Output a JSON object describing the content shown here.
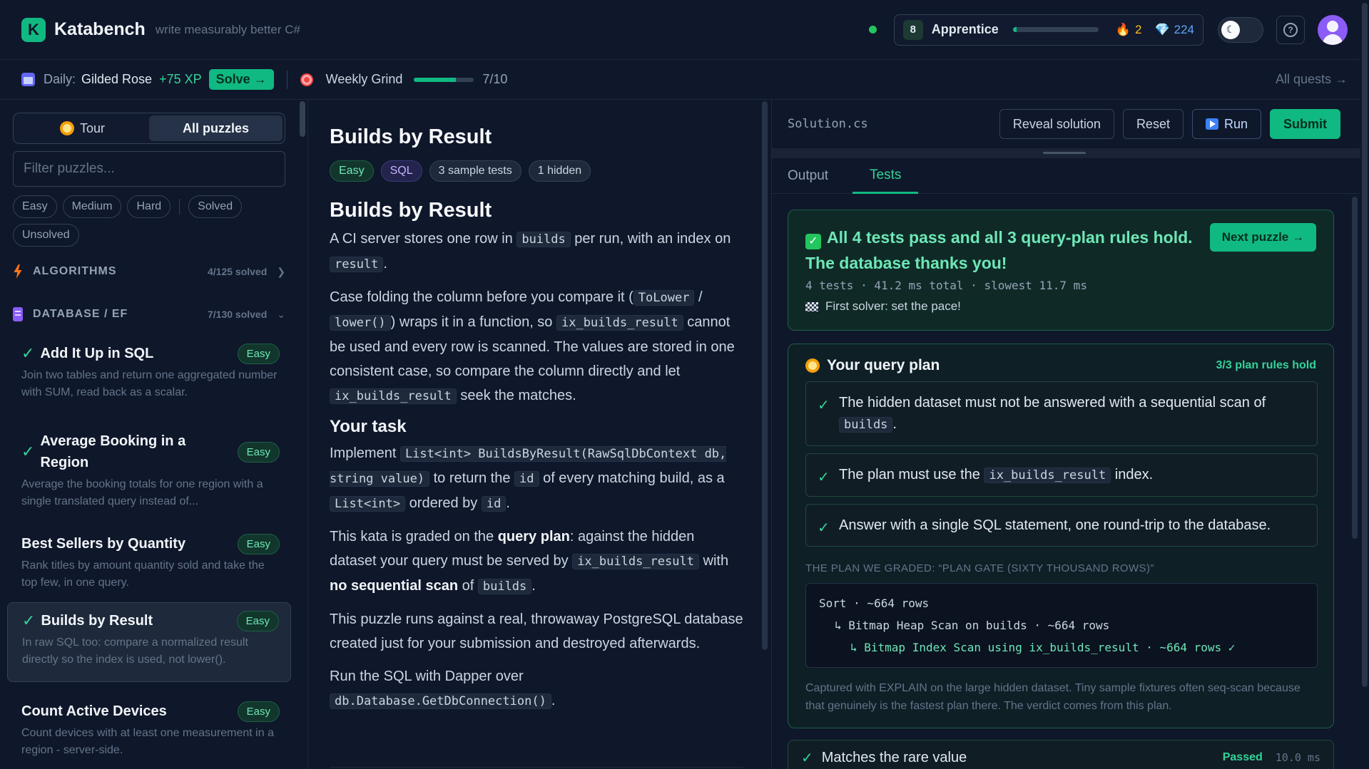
{
  "header": {
    "brand": "Katabench",
    "tagline": "write measurably better C#",
    "rank_level": "8",
    "rank_name": "Apprentice",
    "rank_progress": 0.04,
    "streak": "2",
    "gems": "224"
  },
  "quest": {
    "daily_label": "Daily:",
    "daily_name": "Gilded Rose",
    "daily_xp": "+75 XP",
    "solve_label": "Solve →",
    "weekly_label": "Weekly Grind",
    "weekly_progress": 0.7,
    "weekly_count": "7/10",
    "all_quests": "All quests →"
  },
  "sidebar": {
    "tour_label": "Tour",
    "all_label": "All puzzles",
    "filter_placeholder": "Filter puzzles...",
    "chips": [
      "Easy",
      "Medium",
      "Hard",
      "Solved",
      "Unsolved"
    ],
    "sections": [
      {
        "title": "ALGORITHMS",
        "count": "4/125 solved"
      },
      {
        "title": "DATABASE / EF",
        "count": "7/130 solved"
      }
    ],
    "puzzles": [
      {
        "title": "Add It Up in SQL",
        "badge": "Easy",
        "desc": "Join two tables and return one aggregated number with SUM, read back as a scalar.",
        "solved": true
      },
      {
        "title": "Average Booking in a Region",
        "badge": "Easy",
        "desc": "Average the booking totals for one region with a single translated query instead of...",
        "solved": true
      },
      {
        "title": "Best Sellers by Quantity",
        "badge": "Easy",
        "desc": "Rank titles by amount quantity sold and take the top few, in one query.",
        "solved": false
      },
      {
        "title": "Builds by Result",
        "badge": "Easy",
        "desc": "In raw SQL too: compare a normalized result directly so the index is used, not lower().",
        "solved": true
      },
      {
        "title": "Count Active Devices",
        "badge": "Easy",
        "desc": "Count devices with at least one measurement in a region - server-side.",
        "solved": false
      }
    ]
  },
  "description": {
    "title": "Builds by Result",
    "tags": [
      "Easy",
      "SQL",
      "3 sample tests",
      "1 hidden"
    ],
    "heading": "Builds by Result",
    "p1_a": "A CI server stores one row in ",
    "p1_code1": "builds",
    "p1_b": " per run, with an index on ",
    "p1_code2": "result",
    "p1_c": ".",
    "p2_a": "Case folding the column before you compare it (",
    "p2_code1": "ToLower",
    "p2_b": " / ",
    "p2_code2": "lower()",
    "p2_c": ") wraps it in a function, so ",
    "p2_code3": "ix_builds_result",
    "p2_d": " cannot be used and every row is scanned. The values are stored in one consistent case, so compare the column directly and let ",
    "p2_code4": "ix_builds_result",
    "p2_e": " seek the matches.",
    "task_heading": "Your task",
    "p3_a": "Implement ",
    "p3_code1": "List<int> BuildsByResult(RawSqlDbContext db, string value)",
    "p3_b": " to return the ",
    "p3_code2": "id",
    "p3_c": " of every matching build, as a ",
    "p3_code3": "List<int>",
    "p3_d": " ordered by ",
    "p3_code4": "id",
    "p3_e": ".",
    "p4_a": "This kata is graded on the ",
    "p4_b1": "query plan",
    "p4_b": ": against the hidden dataset your query must be served by ",
    "p4_code1": "ix_builds_result",
    "p4_c": " with ",
    "p4_b2": "no sequential scan",
    "p4_d": " of ",
    "p4_code2": "builds",
    "p4_e": ".",
    "p5": "This puzzle runs against a real, throwaway PostgreSQL database created just for your submission and destroyed afterwards.",
    "p6_a": "Run the SQL with Dapper over ",
    "p6_code": "db.Database.GetDbConnection()",
    "p6_b": "."
  },
  "editor": {
    "file": "Solution.cs",
    "reveal": "Reveal solution",
    "reset": "Reset",
    "run": "Run",
    "submit": "Submit"
  },
  "results": {
    "tabs": [
      "Output",
      "Tests"
    ],
    "pass_title": "All 4 tests pass and all 3 query-plan rules hold. The database thanks you!",
    "pass_stats": "4 tests · 41.2 ms total · slowest 11.7 ms",
    "first_solver": "First solver: set the pace!",
    "next": "Next puzzle →",
    "plan_title": "Your query plan",
    "plan_count": "3/3 plan rules hold",
    "rule1_a": "The hidden dataset must not be answered with a sequential scan of ",
    "rule1_code": "builds",
    "rule1_b": ".",
    "rule2_a": "The plan must use the ",
    "rule2_code": "ix_builds_result",
    "rule2_b": " index.",
    "rule3": "Answer with a single SQL statement, one round-trip to the database.",
    "graded_label": "THE PLAN WE GRADED: “PLAN GATE (SIXTY THOUSAND ROWS)”",
    "plan_lines": [
      "Sort · ~664 rows",
      "↳ Bitmap Heap Scan on builds · ~664 rows",
      "↳ Bitmap Index Scan using ix_builds_result · ~664 rows ✓"
    ],
    "plan_note": "Captured with EXPLAIN on the large hidden dataset. Tiny sample fixtures often seq-scan because that genuinely is the fastest plan there. The verdict comes from this plan.",
    "test_name": "Matches the rare value",
    "test_status": "Passed",
    "test_time": "10.0 ms"
  },
  "icons": {
    "logo": "k-logo-icon",
    "streak": "flame-icon",
    "gems": "gem-icon",
    "theme": "moon-icon",
    "help": "help-icon",
    "avatar": "user-avatar"
  },
  "colors": {
    "accent": "#10b981",
    "background": "#0f172a",
    "surface": "#1e293b"
  }
}
